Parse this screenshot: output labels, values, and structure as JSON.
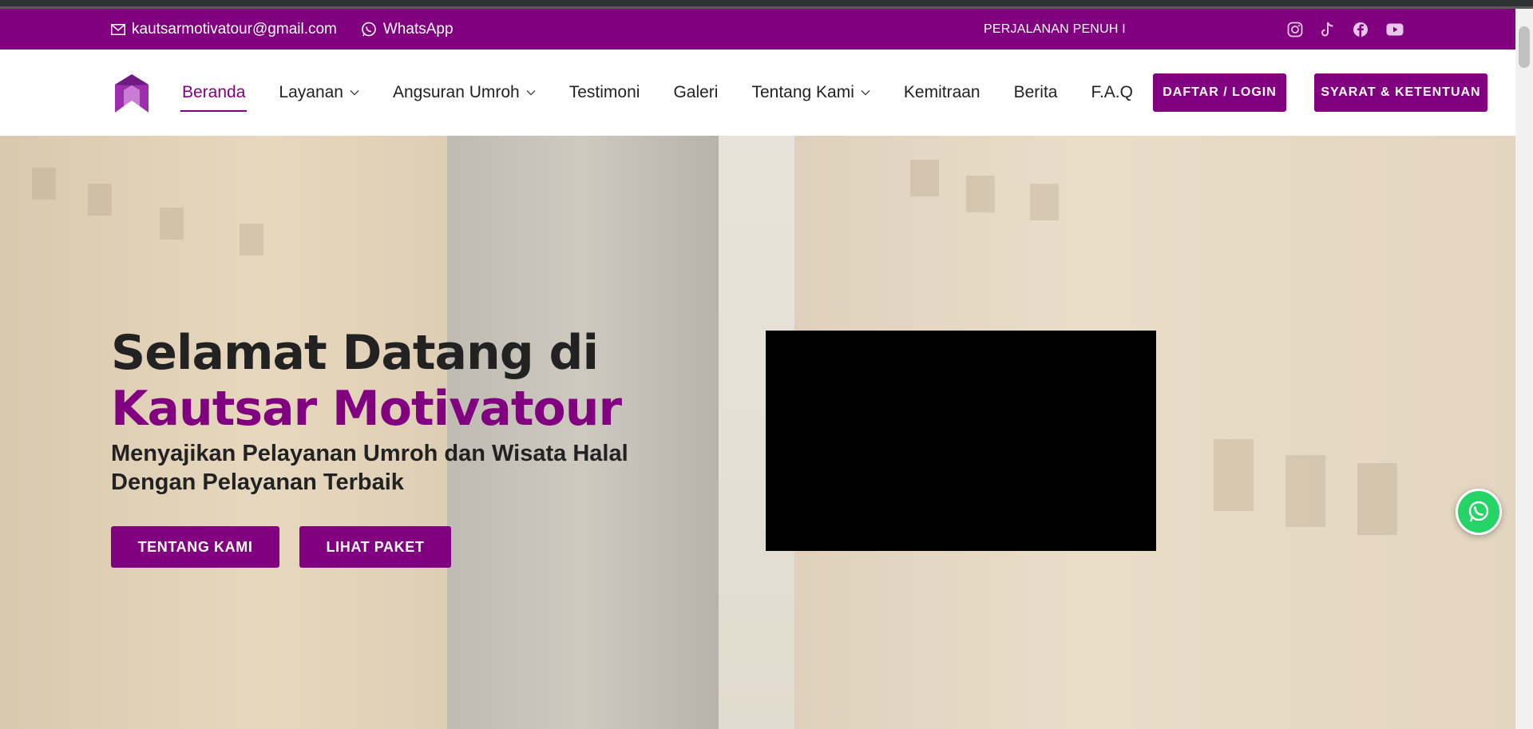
{
  "topbar": {
    "email": "kautsarmotivatour@gmail.com",
    "whatsapp_label": "WhatsApp",
    "marquee_text": "PERJALANAN PENUH I",
    "socials": [
      "instagram-icon",
      "tiktok-icon",
      "facebook-icon",
      "youtube-icon"
    ]
  },
  "nav": {
    "items": [
      {
        "label": "Beranda",
        "active": true,
        "dropdown": false
      },
      {
        "label": "Layanan",
        "active": false,
        "dropdown": true
      },
      {
        "label": "Angsuran Umroh",
        "active": false,
        "dropdown": true
      },
      {
        "label": "Testimoni",
        "active": false,
        "dropdown": false
      },
      {
        "label": "Galeri",
        "active": false,
        "dropdown": false
      },
      {
        "label": "Tentang Kami",
        "active": false,
        "dropdown": true
      },
      {
        "label": "Kemitraan",
        "active": false,
        "dropdown": false
      },
      {
        "label": "Berita",
        "active": false,
        "dropdown": false
      },
      {
        "label": "F.A.Q",
        "active": false,
        "dropdown": false
      }
    ],
    "login_label": "DAFTAR / LOGIN",
    "terms_label": "SYARAT & KETENTUAN"
  },
  "hero": {
    "title_line1": "Selamat Datang di",
    "title_line2": "Kautsar Motivatour",
    "subtitle": "Menyajikan Pelayanan Umroh dan Wisata Halal Dengan Pelayanan Terbaik",
    "about_button": "TENTANG KAMI",
    "packages_button": "LIHAT PAKET"
  },
  "colors": {
    "brand": "#810080",
    "whatsapp": "#25d366"
  }
}
